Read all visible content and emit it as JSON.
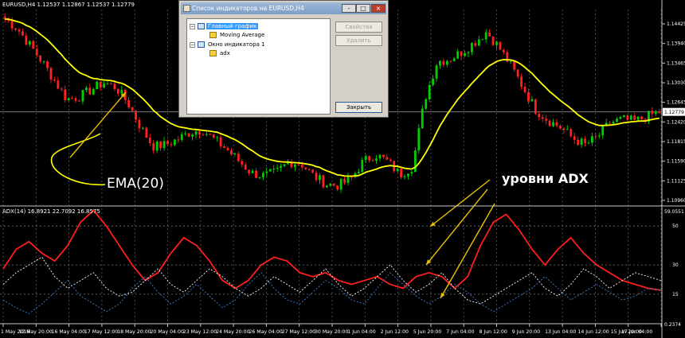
{
  "main_chart": {
    "label": "EURUSD,H4  1.12537 1.12867 1.12537 1.12779",
    "current_price": "1.12779",
    "price_levels": [
      "1.14425",
      "1.13940",
      "1.13465",
      "1.13030",
      "1.12645",
      "1.12420",
      "1.11815",
      "1.11590",
      "1.11125",
      "1.10960"
    ]
  },
  "indicator_window": {
    "label": "ADX(14) 16.8921 22.7092 16.8575",
    "max_label": "59.0551",
    "levels": [
      "50",
      "30",
      "15"
    ],
    "min_label": "0.2374"
  },
  "time_axis": [
    "1 May 2016",
    "12 May 20:00",
    "16 May 04:00",
    "17 May 12:00",
    "18 May 20:00",
    "20 May 04:00",
    "23 May 12:00",
    "24 May 20:00",
    "26 May 04:00",
    "27 May 12:00",
    "30 May 20:00",
    "1 Jun 04:00",
    "2 Jun 12:00",
    "5 Jun 20:00",
    "7 Jun 04:00",
    "8 Jun 12:00",
    "9 Jun 20:00",
    "13 Jun 04:00",
    "14 Jun 12:00",
    "15 Jun 20:00",
    "17 Jun 04:00"
  ],
  "annotations": {
    "ema_label": "EMA(20)",
    "adx_label": "уровни ADX"
  },
  "dialog": {
    "title": "Список индикаторов на EURUSD,H4",
    "buttons": {
      "minimize": "-",
      "maximize": "□",
      "close": "×"
    },
    "tree": {
      "main_chart": "Главный график",
      "moving_average": "Moving Average",
      "indicator_window": "Окно индикатора 1",
      "adx": "adx"
    },
    "actions": {
      "properties": "Свойства",
      "delete": "Удалить",
      "close": "Закрыть"
    }
  },
  "colors": {
    "background": "#000000",
    "bull": "#00d000",
    "bear": "#ff2020",
    "ema": "#ffff00",
    "adx_main": "#ff1e1e",
    "di_plus": "#ffffff",
    "di_minus": "#3f7fd0",
    "arrow": "#e8c000"
  },
  "chart_data": [
    {
      "type": "candlestick",
      "symbol": "EURUSD",
      "timeframe": "H4",
      "ylim": [
        1.108,
        1.1495
      ],
      "ohlc_last": {
        "open": 1.12537,
        "high": 1.12867,
        "low": 1.12537,
        "close": 1.12779
      },
      "close_path": [
        1.1475,
        1.1455,
        1.142,
        1.1385,
        1.1345,
        1.1305,
        1.131,
        1.1325,
        1.134,
        1.133,
        1.1295,
        1.1245,
        1.1205,
        1.1208,
        1.122,
        1.1235,
        1.124,
        1.1218,
        1.1198,
        1.1172,
        1.1148,
        1.1142,
        1.115,
        1.1172,
        1.1168,
        1.1142,
        1.1125,
        1.1122,
        1.1135,
        1.1172,
        1.1188,
        1.1172,
        1.1145,
        1.1162,
        1.1305,
        1.1385,
        1.139,
        1.1405,
        1.1425,
        1.1448,
        1.1415,
        1.1375,
        1.1328,
        1.1282,
        1.126,
        1.1245,
        1.1222,
        1.1208,
        1.1225,
        1.1255,
        1.1262,
        1.1258,
        1.1268,
        1.1278
      ],
      "ema_period": 20
    },
    {
      "type": "line",
      "indicator": "ADX",
      "period": 14,
      "last_values": {
        "adx": 16.8921,
        "plus_di": 22.7092,
        "minus_di": 16.8575
      },
      "ylim": [
        0.2374,
        59.0551
      ],
      "levels": [
        50,
        30,
        15
      ],
      "series": [
        {
          "values": [
            28,
            38,
            42,
            36,
            32,
            40,
            52,
            58,
            50,
            40,
            30,
            22,
            26,
            36,
            44,
            40,
            32,
            22,
            18,
            22,
            30,
            34,
            32,
            26,
            24,
            26,
            22,
            20,
            22,
            24,
            20,
            18,
            24,
            26,
            24,
            18,
            24,
            40,
            52,
            56,
            48,
            38,
            30,
            38,
            44,
            36,
            30,
            26,
            22,
            20,
            18,
            17
          ]
        },
        {
          "values": [
            20,
            26,
            30,
            34,
            24,
            18,
            22,
            26,
            18,
            14,
            16,
            22,
            28,
            20,
            16,
            22,
            28,
            24,
            18,
            14,
            18,
            24,
            20,
            16,
            22,
            28,
            20,
            14,
            18,
            24,
            30,
            22,
            16,
            20,
            26,
            18,
            12,
            10,
            14,
            18,
            22,
            26,
            18,
            14,
            20,
            28,
            24,
            18,
            22,
            26,
            24,
            22
          ]
        },
        {
          "values": [
            12,
            8,
            5,
            10,
            16,
            22,
            14,
            10,
            6,
            10,
            18,
            24,
            16,
            10,
            14,
            20,
            14,
            8,
            12,
            20,
            26,
            18,
            12,
            10,
            16,
            22,
            18,
            12,
            10,
            18,
            26,
            20,
            14,
            10,
            14,
            20,
            16,
            10,
            6,
            10,
            14,
            18,
            24,
            18,
            12,
            16,
            20,
            16,
            12,
            14,
            18,
            17
          ]
        }
      ]
    }
  ]
}
